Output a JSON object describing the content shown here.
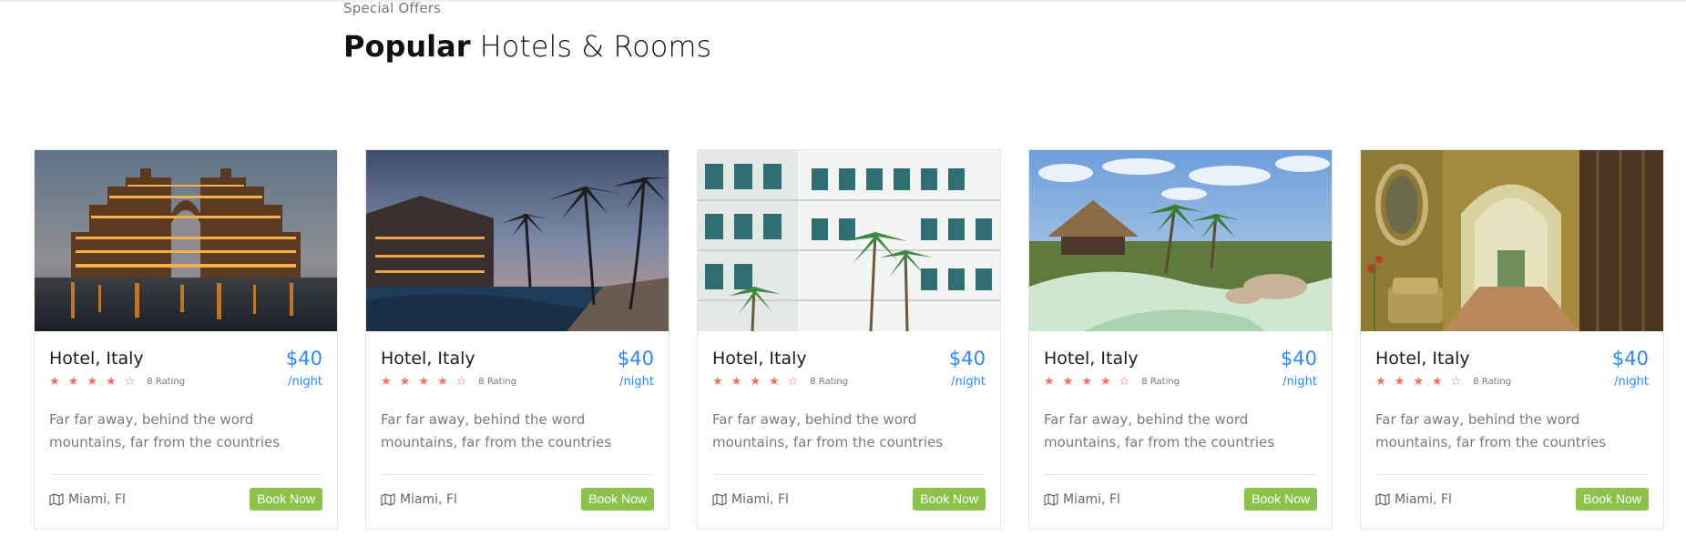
{
  "section": {
    "subheading": "Special Offers",
    "heading_bold": "Popular",
    "heading_rest": " Hotels & Rooms"
  },
  "colors": {
    "price": "#2f89fc",
    "star": "#f96d63",
    "button": "#8bc34a"
  },
  "cards": [
    {
      "image": "hotel-palace-night-photo",
      "title": "Hotel, Italy",
      "price": "$40",
      "per": "/night",
      "stars_filled": 4,
      "stars_total": 5,
      "rating": "8 Rating",
      "description": "Far far away, behind the word mountains, far from the countries",
      "location": "Miami, Fl",
      "button": "Book Now"
    },
    {
      "image": "resort-palms-pool-photo",
      "title": "Hotel, Italy",
      "price": "$40",
      "per": "/night",
      "stars_filled": 4,
      "stars_total": 5,
      "rating": "8 Rating",
      "description": "Far far away, behind the word mountains, far from the countries",
      "location": "Miami, Fl",
      "button": "Book Now"
    },
    {
      "image": "hotel-courtyard-balconies-photo",
      "title": "Hotel, Italy",
      "price": "$40",
      "per": "/night",
      "stars_filled": 4,
      "stars_total": 5,
      "rating": "8 Rating",
      "description": "Far far away, behind the word mountains, far from the countries",
      "location": "Miami, Fl",
      "button": "Book Now"
    },
    {
      "image": "tropical-lagoon-huts-photo",
      "title": "Hotel, Italy",
      "price": "$40",
      "per": "/night",
      "stars_filled": 4,
      "stars_total": 5,
      "rating": "8 Rating",
      "description": "Far far away, behind the word mountains, far from the countries",
      "location": "Miami, Fl",
      "button": "Book Now"
    },
    {
      "image": "hotel-lobby-arches-photo",
      "title": "Hotel, Italy",
      "price": "$40",
      "per": "/night",
      "stars_filled": 4,
      "stars_total": 5,
      "rating": "8 Rating",
      "description": "Far far away, behind the word mountains, far from the countries",
      "location": "Miami, Fl",
      "button": "Book Now"
    }
  ]
}
